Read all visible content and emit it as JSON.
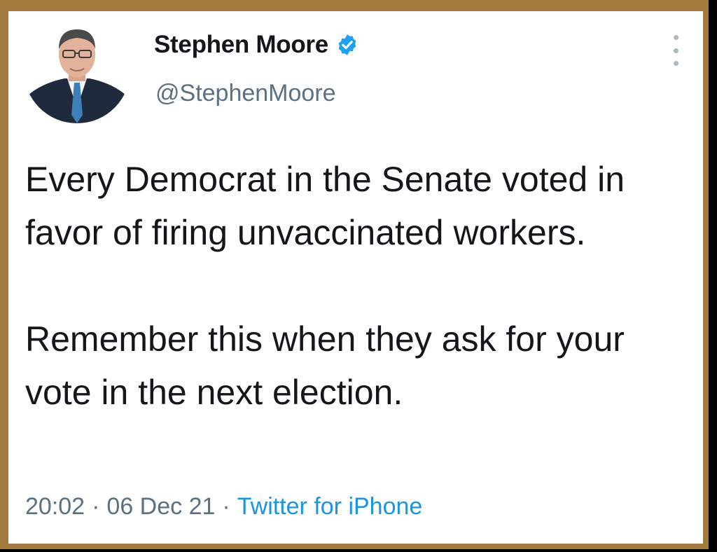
{
  "tweet": {
    "author": {
      "name": "Stephen Moore",
      "handle": "@StephenMoore",
      "verified": true
    },
    "text": {
      "paragraph_1": "Every Democrat in the Senate voted in favor of firing unvaccinated workers.",
      "paragraph_2": "Remember this when they ask for your vote in the next election."
    },
    "meta": {
      "time": "20:02",
      "date": "06 Dec 21",
      "separator": "·",
      "source": "Twitter for iPhone"
    }
  },
  "icons": {
    "verified": "verified-badge-icon",
    "more": "more-options-icon"
  },
  "colors": {
    "frame": "#a27a3e",
    "card": "#ffffff",
    "text": "#14171a",
    "muted": "#5b7083",
    "link": "#1b95e0",
    "verified": "#1da1f2"
  }
}
